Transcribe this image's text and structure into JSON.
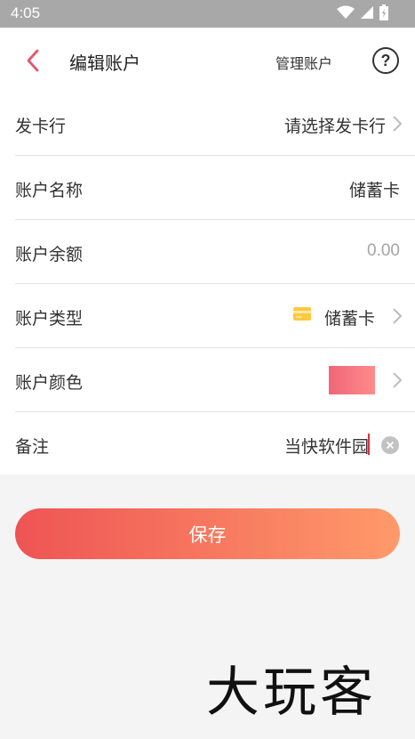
{
  "status_bar": {
    "time": "4:05",
    "icons": [
      "wifi-icon",
      "cellular-icon",
      "battery-icon"
    ]
  },
  "app_bar": {
    "title": "编辑账户",
    "manage_label": "管理账户",
    "help_label": "?"
  },
  "form": {
    "issuer": {
      "label": "发卡行",
      "value": "请选择发卡行"
    },
    "name": {
      "label": "账户名称",
      "value": "储蓄卡"
    },
    "balance": {
      "label": "账户余额",
      "placeholder": "0.00"
    },
    "type": {
      "label": "账户类型",
      "value": "储蓄卡",
      "icon": "card-icon"
    },
    "color": {
      "label": "账户颜色",
      "swatch_colors": [
        "#f06676",
        "#ff8b8b"
      ]
    },
    "note": {
      "label": "备注",
      "value": "当快软件园"
    }
  },
  "save_button": {
    "label": "保存"
  },
  "watermark": {
    "text": "大玩客"
  },
  "colors": {
    "accent": "#ee5454",
    "accent_end": "#ff9a6a",
    "back_arrow": "#e8566a"
  }
}
